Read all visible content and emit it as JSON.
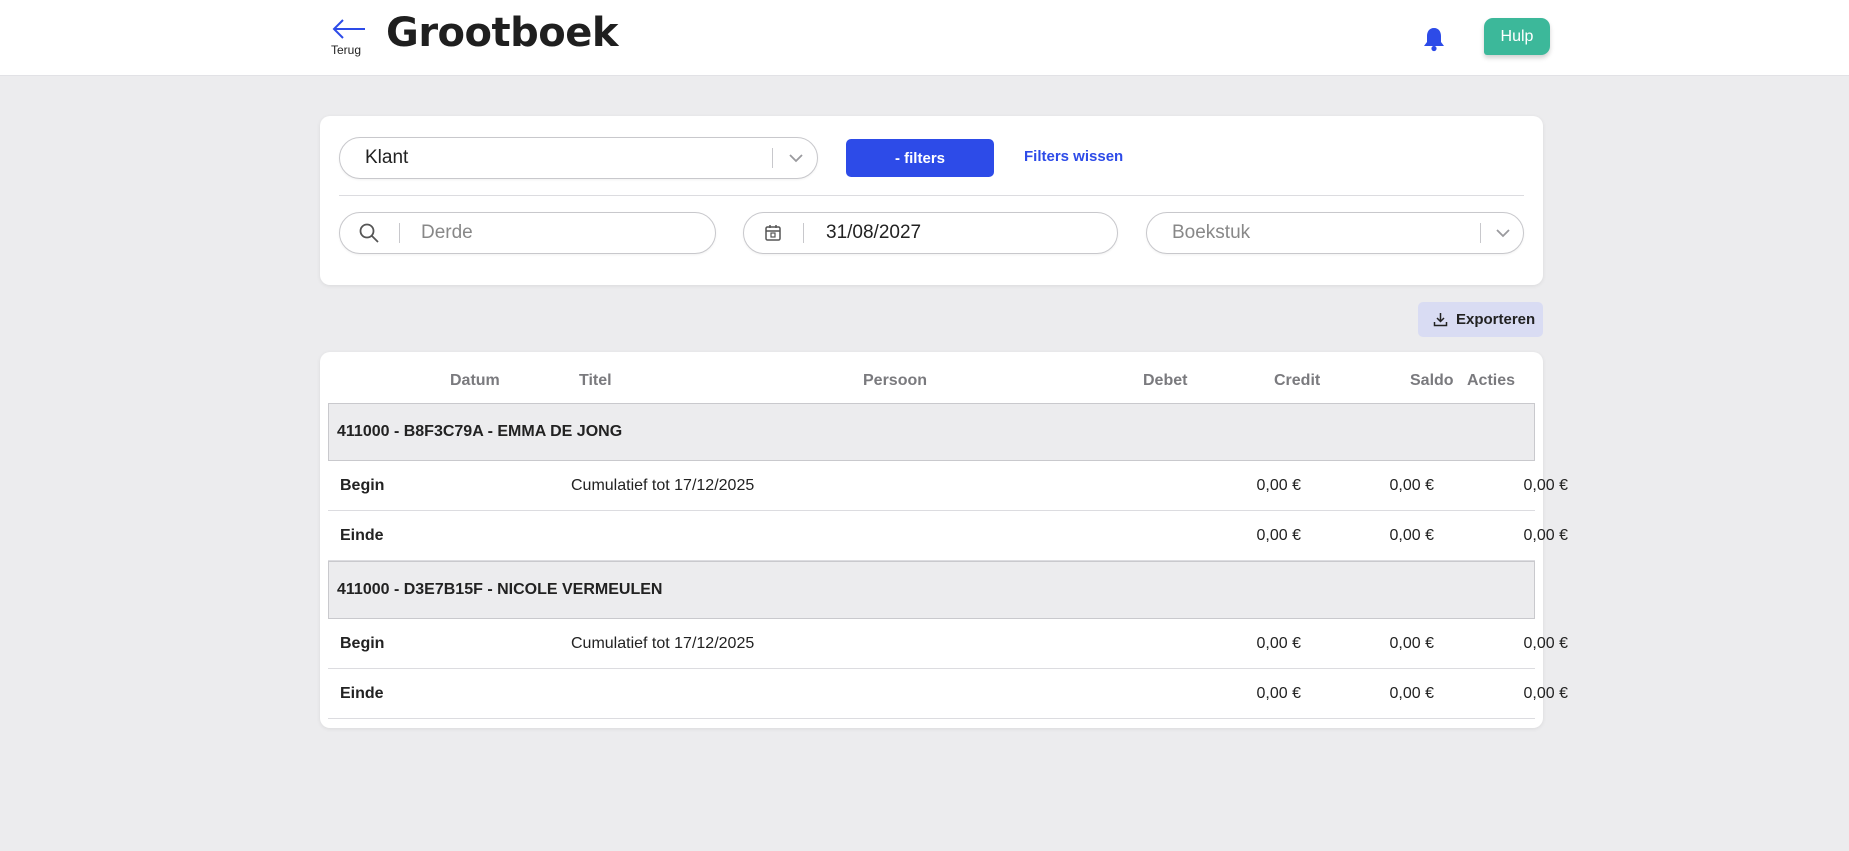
{
  "header": {
    "back_label": "Terug",
    "title": "Grootboek",
    "help_label": "Hulp"
  },
  "filters": {
    "account_type_value": "Klant",
    "toggle_filters_label": "- filters",
    "clear_filters_label": "Filters wissen",
    "third_party_placeholder": "Derde",
    "date_value": "31/08/2027",
    "document_placeholder": "Boekstuk"
  },
  "export_label": "Exporteren",
  "table": {
    "columns": {
      "date": "Datum",
      "title": "Titel",
      "person": "Persoon",
      "debit": "Debet",
      "credit": "Credit",
      "balance": "Saldo",
      "actions": "Acties"
    },
    "groups": [
      {
        "header": "411000 - B8F3C79A - EMMA DE JONG",
        "rows": [
          {
            "label": "Begin",
            "title": "Cumulatief tot 17/12/2025",
            "debit": "0,00 €",
            "credit": "0,00 €",
            "balance": "0,00 €"
          },
          {
            "label": "Einde",
            "title": "",
            "debit": "0,00 €",
            "credit": "0,00 €",
            "balance": "0,00 €"
          }
        ]
      },
      {
        "header": "411000 - D3E7B15F - NICOLE VERMEULEN",
        "rows": [
          {
            "label": "Begin",
            "title": "Cumulatief tot 17/12/2025",
            "debit": "0,00 €",
            "credit": "0,00 €",
            "balance": "0,00 €"
          },
          {
            "label": "Einde",
            "title": "",
            "debit": "0,00 €",
            "credit": "0,00 €",
            "balance": "0,00 €"
          }
        ]
      }
    ]
  },
  "colors": {
    "primary": "#2d4be8",
    "help": "#3cb89a",
    "export_bg": "#d9dcf3",
    "background": "#ececee"
  }
}
